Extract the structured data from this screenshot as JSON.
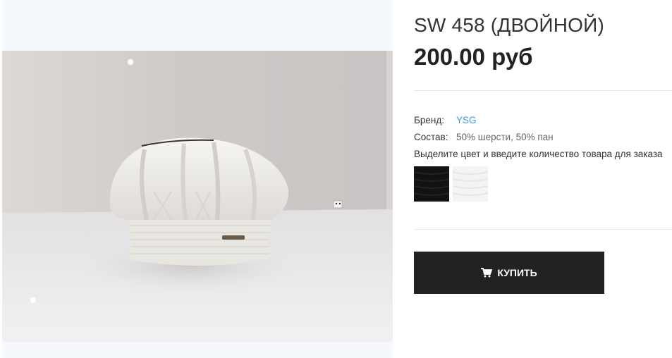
{
  "product": {
    "title": "SW 458 (ДВОЙНОЙ)",
    "price": "200.00 руб",
    "image_alt": "white knitted beret"
  },
  "attributes": {
    "brand_label": "Бренд:",
    "brand_value": "YSG",
    "composition_label": "Состав:",
    "composition_value": "50% шерсти, 50% пан"
  },
  "variant_hint": "Выделите цвет и введите количество товара для заказа",
  "swatches": [
    {
      "color_name": "black",
      "color": "#111111"
    },
    {
      "color_name": "white",
      "color": "#f4f2f3"
    }
  ],
  "buy_button": {
    "label": "КУПИТЬ",
    "icon": "cart-icon"
  },
  "colors": {
    "link": "#3a9ad9",
    "button_bg": "#222222",
    "gallery_bg": "#f5f9fd"
  }
}
